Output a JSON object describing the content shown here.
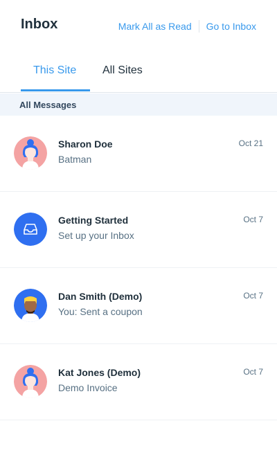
{
  "header": {
    "title": "Inbox",
    "mark_all_read": "Mark All as Read",
    "go_to_inbox": "Go to Inbox"
  },
  "tabs": [
    {
      "label": "This Site",
      "active": true
    },
    {
      "label": "All Sites",
      "active": false
    }
  ],
  "section": {
    "label": "All Messages"
  },
  "colors": {
    "accent": "#3899ec",
    "avatar_pink": "#f4a3a3",
    "avatar_blue": "#2f6ff0"
  },
  "messages": [
    {
      "name": "Sharon Doe",
      "preview": "Batman",
      "date": "Oct 21",
      "avatar": "woman-avatar-icon"
    },
    {
      "name": "Getting Started",
      "preview": "Set up your Inbox",
      "date": "Oct 7",
      "avatar": "inbox-tray-icon"
    },
    {
      "name": "Dan Smith (Demo)",
      "preview": "You: Sent a coupon",
      "date": "Oct 7",
      "avatar": "man-avatar-icon"
    },
    {
      "name": "Kat Jones (Demo)",
      "preview": "Demo Invoice",
      "date": "Oct 7",
      "avatar": "woman-avatar-icon"
    }
  ]
}
